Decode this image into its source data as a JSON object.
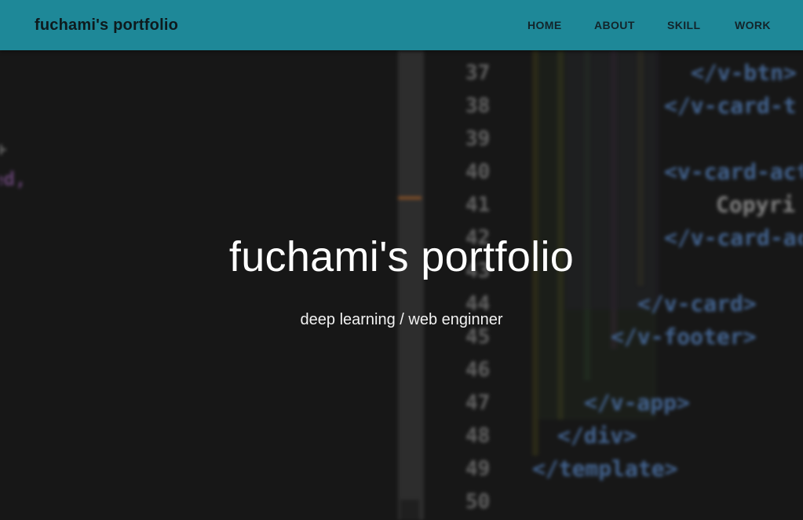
{
  "header": {
    "brand": "fuchami's portfolio",
    "nav": [
      {
        "label": "HOME",
        "id": "home"
      },
      {
        "label": "ABOUT",
        "id": "about"
      },
      {
        "label": "SKILL",
        "id": "skill"
      },
      {
        "label": "WORK",
        "id": "work"
      }
    ]
  },
  "hero": {
    "title": "fuchami's portfolio",
    "subtitle": "deep learning / web enginner"
  },
  "background_code": {
    "line_numbers": [
      "37",
      "38",
      "39",
      "40",
      "41",
      "42",
      "43",
      "44",
      "45",
      "46",
      "47",
      "48",
      "49",
      "50"
    ],
    "lines": [
      {
        "text": "</v-btn>"
      },
      {
        "text": "</v-card-t"
      },
      {
        "text": "<v-card-act"
      },
      {
        "text": "Copyri"
      },
      {
        "text": "</v-card-ac"
      },
      {
        "text": "</v-card>"
      },
      {
        "text": "</v-footer>"
      },
      {
        "text": "</v-app>"
      },
      {
        "text": "</div>"
      },
      {
        "text": "</template>"
      }
    ]
  },
  "colors": {
    "header_bg": "#1e8898",
    "page_bg": "#1a1a1a",
    "code_tag": "#5d8fd3"
  }
}
